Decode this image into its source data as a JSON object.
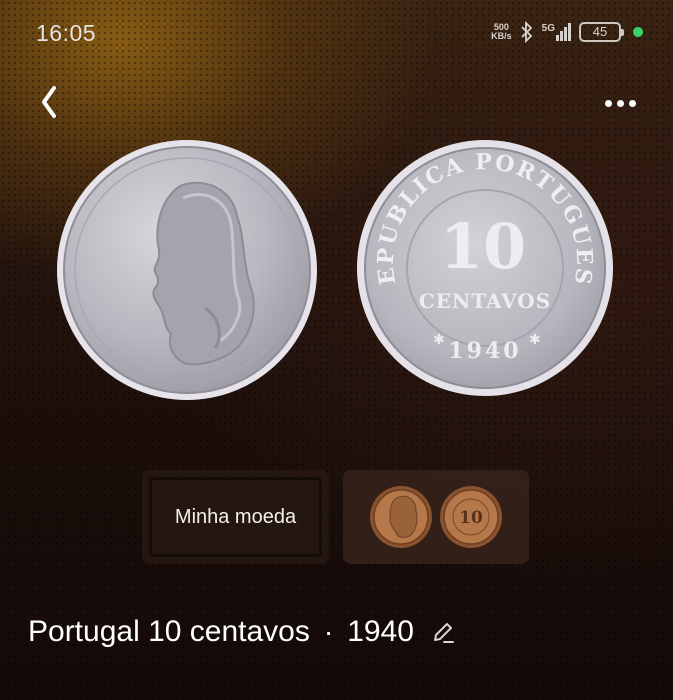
{
  "status": {
    "time": "16:05",
    "net_speed_value": "500",
    "net_speed_unit": "KB/s",
    "network": "5G",
    "battery": "45"
  },
  "icons": {
    "back": "chevron-left-icon",
    "more": "more-horizontal-icon",
    "bluetooth": "bluetooth-icon",
    "signal": "signal-icon",
    "edit": "pencil-icon"
  },
  "coin": {
    "obverse_alt": "Coin obverse: female head in profile",
    "reverse_text_top": "REPUBLICA PORTUGUESA",
    "reverse_value": "10",
    "reverse_unit": "CENTAVOS",
    "reverse_year": "1940"
  },
  "thumbnails": {
    "my_coin_label": "Minha moeda"
  },
  "title": {
    "name": "Portugal 10 centavos",
    "separator": "·",
    "year": "1940"
  },
  "colors": {
    "status_dot": "#37d46a",
    "coin_silver": "#c9c7cc",
    "coin_bronze": "#b5784a"
  }
}
